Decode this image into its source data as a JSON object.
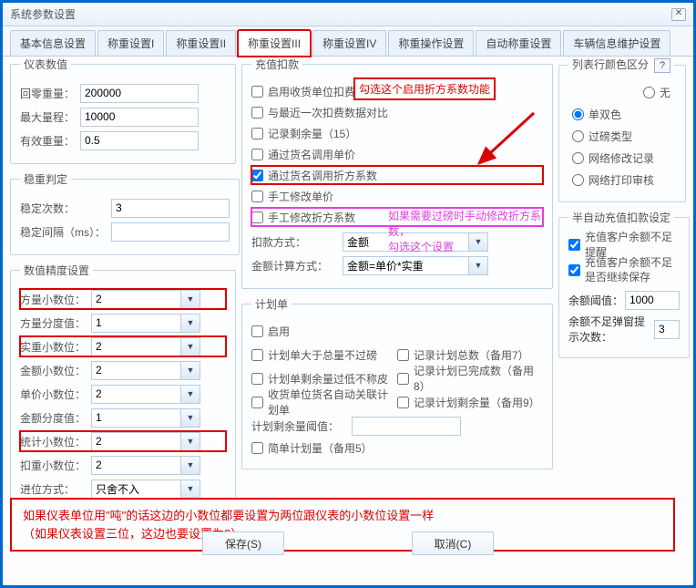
{
  "title": "系统参数设置",
  "tabs": [
    "基本信息设置",
    "称重设置I",
    "称重设置II",
    "称重设置III",
    "称重设置IV",
    "称重操作设置",
    "自动称重设置",
    "车辆信息维护设置"
  ],
  "activeTab": 3,
  "meter": {
    "legend": "仪表数值",
    "rows": [
      {
        "label": "回零重量：",
        "value": "200000"
      },
      {
        "label": "最大量程：",
        "value": "10000"
      },
      {
        "label": "有效重量：",
        "value": "0.5"
      }
    ]
  },
  "stable": {
    "legend": "稳重判定",
    "rows": [
      {
        "label": "稳定次数：",
        "value": "3"
      },
      {
        "label": "稳定间隔（ms）：",
        "value": ""
      }
    ]
  },
  "precision": {
    "legend": "数值精度设置",
    "rows": [
      {
        "label": "方量小数位：",
        "value": "2",
        "red": true
      },
      {
        "label": "方量分度值：",
        "value": "1"
      },
      {
        "label": "实重小数位：",
        "value": "2",
        "red": true
      },
      {
        "label": "金额小数位：",
        "value": "2"
      },
      {
        "label": "单价小数位：",
        "value": "2"
      },
      {
        "label": "金额分度值：",
        "value": "1"
      },
      {
        "label": "统计小数位：",
        "value": "2",
        "red": true
      },
      {
        "label": "扣重小数位：",
        "value": "2"
      },
      {
        "label": "进位方式：",
        "value": "只舍不入"
      }
    ]
  },
  "charge": {
    "legend": "充值扣款",
    "checks": [
      {
        "label": "启用收货单位扣费",
        "c": false
      },
      {
        "label": "与最近一次扣费数据对比",
        "c": false
      },
      {
        "label": "记录剩余量（15）",
        "c": false
      },
      {
        "label": "通过货名调用单价",
        "c": false
      },
      {
        "label": "通过货名调用折方系数",
        "c": true,
        "red": true
      },
      {
        "label": "手工修改单价",
        "c": false
      },
      {
        "label": "手工修改折方系数",
        "c": false,
        "pink": true
      }
    ],
    "rows": [
      {
        "label": "扣款方式：",
        "value": "金额"
      },
      {
        "label": "金额计算方式：",
        "value": "金额=单价*实重"
      }
    ]
  },
  "plan": {
    "legend": "计划单",
    "enable": {
      "label": "启用"
    },
    "left": [
      "计划单大于总量不过磅",
      "计划单剩余量过低不称皮",
      "收货单位货名自动关联计划单"
    ],
    "right": [
      "记录计划总数（备用7）",
      "记录计划已完成数（备用8）",
      "记录计划剩余量（备用9）"
    ],
    "thresholdLabel": "计划剩余量阈值：",
    "simple": "简单计划量（备用5）"
  },
  "colorGroup": {
    "legend": "列表行颜色区分",
    "none": "无",
    "radios": [
      "单双色",
      "过磅类型",
      "网络修改记录",
      "网络打印审核"
    ]
  },
  "semiAuto": {
    "legend": "半自动充值扣款设定",
    "c1": "充值客户余额不足提醒",
    "c2": "充值客户余额不足是否继续保存",
    "balLabel": "余额阈值：",
    "balVal": "1000",
    "popLabel": "余额不足弹窗提示次数：",
    "popVal": "3"
  },
  "anno": {
    "a1": "勾选这个启用折方系数功能",
    "a2_l1": "如果需要过磅时手动修改折方系数，",
    "a2_l2": "勾选这个设置",
    "note_l1": "如果仪表单位用\"吨\"的话这边的小数位都要设置为两位跟仪表的小数位设置一样",
    "note_l2": "（如果仪表设置三位，这边也要设置为3）"
  },
  "btns": {
    "save": "保存(S)",
    "cancel": "取消(C)"
  }
}
